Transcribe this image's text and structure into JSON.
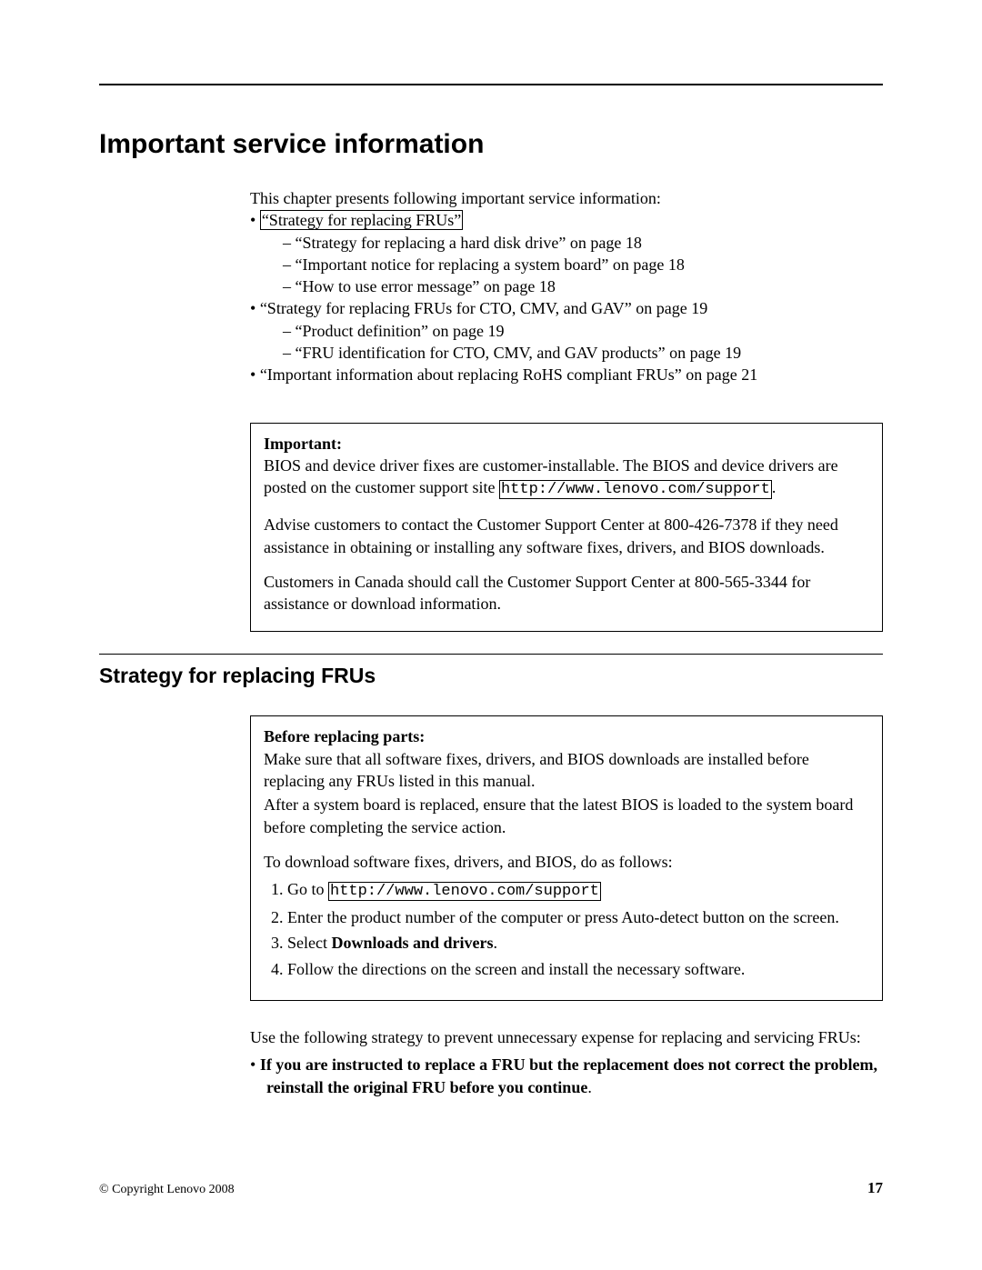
{
  "title": "Important service information",
  "intro": "This chapter presents following important service information:",
  "toc": {
    "i0": {
      "link": "“Strategy for replacing FRUs”",
      "s0": "“Strategy for replacing a hard disk drive” on page 18",
      "s1": "“Important notice for replacing a system board” on page 18",
      "s2": "“How to use error message” on page 18"
    },
    "i1": {
      "text": "“Strategy for replacing FRUs for CTO, CMV, and GAV” on page 19",
      "s0": "“Product definition” on page 19",
      "s1": "“FRU identification for CTO, CMV, and GAV products” on page 19"
    },
    "i2": {
      "text": "“Important information about replacing RoHS compliant FRUs” on page 21"
    }
  },
  "important_box": {
    "label": "Important:",
    "p1a": "BIOS and device driver fixes are customer-installable. The BIOS and device drivers are posted on the customer support site ",
    "p1_link": "http://www.lenovo.com/support",
    "p1b": ".",
    "p2": "Advise customers to contact the Customer Support Center at 800-426-7378 if they need assistance in obtaining or installing any software fixes, drivers, and BIOS downloads.",
    "p3": "Customers in Canada should call the Customer Support Center at 800-565-3344 for assistance or download information."
  },
  "section2_title": "Strategy for replacing FRUs",
  "before_box": {
    "label": "Before replacing parts:",
    "p1": "Make sure that all software fixes, drivers, and BIOS downloads are installed before replacing any FRUs listed in this manual.",
    "p2": "After a system board is replaced, ensure that the latest BIOS is loaded to the system board before completing the service action.",
    "p3": "To download software fixes, drivers, and BIOS, do as follows:",
    "step1a": "Go to ",
    "step1_link": "http://www.lenovo.com/support",
    "step2": "Enter the product number of the computer or press Auto-detect button on the screen.",
    "step3a": "Select ",
    "step3b": "Downloads and drivers",
    "step3c": ".",
    "step4": "Follow the directions on the screen and install the necessary software."
  },
  "strategy_intro": "Use the following strategy to prevent unnecessary expense for replacing and servicing FRUs:",
  "strategy_b1a": "If you are instructed to replace a FRU but the replacement does not correct the problem, reinstall the original FRU before you continue",
  "strategy_b1b": ".",
  "footer_copyright": "© Copyright Lenovo 2008",
  "footer_page": "17"
}
